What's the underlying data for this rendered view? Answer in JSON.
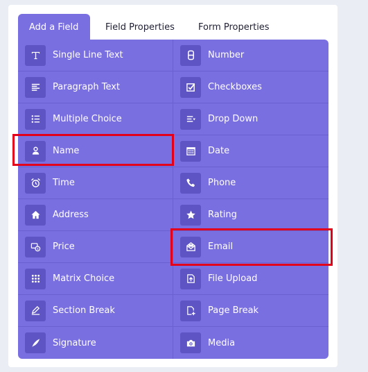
{
  "tabs": [
    {
      "label": "Add a Field"
    },
    {
      "label": "Field Properties"
    },
    {
      "label": "Form Properties"
    }
  ],
  "fields": [
    {
      "label": "Single Line Text",
      "icon": "text-t-icon"
    },
    {
      "label": "Number",
      "icon": "number-8-icon"
    },
    {
      "label": "Paragraph Text",
      "icon": "paragraph-icon"
    },
    {
      "label": "Checkboxes",
      "icon": "checkbox-icon"
    },
    {
      "label": "Multiple Choice",
      "icon": "list-icon"
    },
    {
      "label": "Drop Down",
      "icon": "dropdown-icon"
    },
    {
      "label": "Name",
      "icon": "person-icon"
    },
    {
      "label": "Date",
      "icon": "calendar-icon"
    },
    {
      "label": "Time",
      "icon": "alarm-clock-icon"
    },
    {
      "label": "Phone",
      "icon": "phone-icon"
    },
    {
      "label": "Address",
      "icon": "home-icon"
    },
    {
      "label": "Rating",
      "icon": "star-icon"
    },
    {
      "label": "Price",
      "icon": "money-icon"
    },
    {
      "label": "Email",
      "icon": "envelope-icon"
    },
    {
      "label": "Matrix Choice",
      "icon": "grid-dots-icon"
    },
    {
      "label": "File Upload",
      "icon": "upload-icon"
    },
    {
      "label": "Section Break",
      "icon": "pen-icon"
    },
    {
      "label": "Page Break",
      "icon": "page-add-icon"
    },
    {
      "label": "Signature",
      "icon": "quill-icon"
    },
    {
      "label": "Media",
      "icon": "camera-icon"
    }
  ],
  "colors": {
    "accent": "#7a6fe0",
    "icon_bg": "#5e54c4",
    "highlight": "#e3001b"
  }
}
